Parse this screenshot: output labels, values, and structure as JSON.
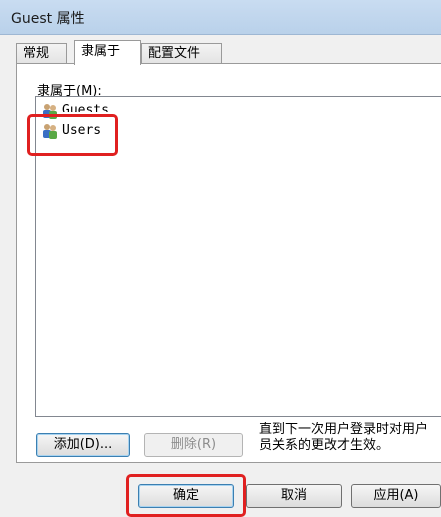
{
  "window": {
    "title": "Guest 属性"
  },
  "tabs": [
    {
      "label": "常规"
    },
    {
      "label": "隶属于"
    },
    {
      "label": "配置文件"
    }
  ],
  "memberOf": {
    "label": "隶属于(M):",
    "items": [
      {
        "name": "Guests",
        "icon": "group-icon"
      },
      {
        "name": "Users",
        "icon": "group-icon"
      }
    ]
  },
  "buttons": {
    "add": "添加(D)...",
    "remove": "删除(R)",
    "ok": "确定",
    "cancel": "取消",
    "apply": "应用(A)"
  },
  "note": {
    "line1": "直到下一次用户登录时对用户",
    "line2": "员关系的更改才生效。"
  },
  "colors": {
    "highlight": "#e02020",
    "titlebar": "#c9dcf1"
  }
}
